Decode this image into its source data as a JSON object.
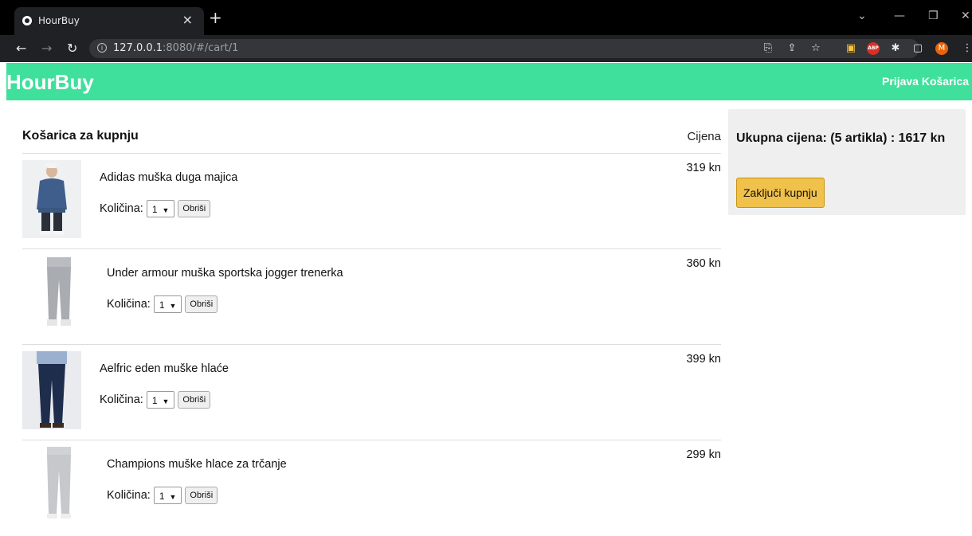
{
  "browser": {
    "tab_title": "HourBuy",
    "url_host": "127.0.0.1",
    "url_rest": ":8080/#/cart/1"
  },
  "app": {
    "brand": "HourBuy",
    "nav_login": "Prijava",
    "nav_cart": "Košarica",
    "accent_color": "#3ee09c"
  },
  "cart": {
    "title": "Košarica za kupnju",
    "price_header": "Cijena",
    "quantity_label": "Količina:",
    "delete_label": "Obriši",
    "items": [
      {
        "name": "Adidas muška duga majica",
        "quantity": "1",
        "price": "319 kn",
        "image": "blue-sweatshirt"
      },
      {
        "name": "Under armour muška sportska jogger trenerka",
        "quantity": "1",
        "price": "360 kn",
        "image": "grey-jogger-pants"
      },
      {
        "name": "Aelfric eden muške hlaće",
        "quantity": "1",
        "price": "399 kn",
        "image": "navy-trousers"
      },
      {
        "name": "Champions muške hlace za trčanje",
        "quantity": "1",
        "price": "299 kn",
        "image": "light-grey-running-pants"
      }
    ]
  },
  "summary": {
    "total_text": "Ukupna cijena: (5 artikla) : 1617 kn",
    "checkout_label": "Zaključi kupnju"
  }
}
